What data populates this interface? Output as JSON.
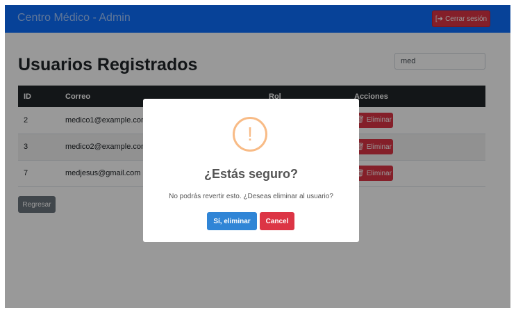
{
  "navbar": {
    "brand": "Centro Médico - Admin",
    "logout_label": "Cerrar sesión"
  },
  "page": {
    "title": "Usuarios Registrados",
    "search_value": "med"
  },
  "table": {
    "headers": [
      "ID",
      "Correo",
      "Rol",
      "Acciones"
    ],
    "rows": [
      {
        "id": "2",
        "email": "medico1@example.com",
        "role": ""
      },
      {
        "id": "3",
        "email": "medico2@example.com",
        "role": ""
      },
      {
        "id": "7",
        "email": "medjesus@gmail.com",
        "role": ""
      }
    ],
    "delete_label": "Eliminar"
  },
  "back_label": "Regresar",
  "modal": {
    "icon": "!",
    "title": "¿Estás seguro?",
    "text": "No podrás revertir esto. ¿Deseas eliminar al usuario?",
    "confirm_label": "Sí, eliminar",
    "cancel_label": "Cancel"
  },
  "colors": {
    "navbar": "#0d6efd",
    "danger": "#dc3545",
    "confirm": "#3085d6",
    "warning_icon": "#f8bb86",
    "secondary": "#6c757d"
  }
}
